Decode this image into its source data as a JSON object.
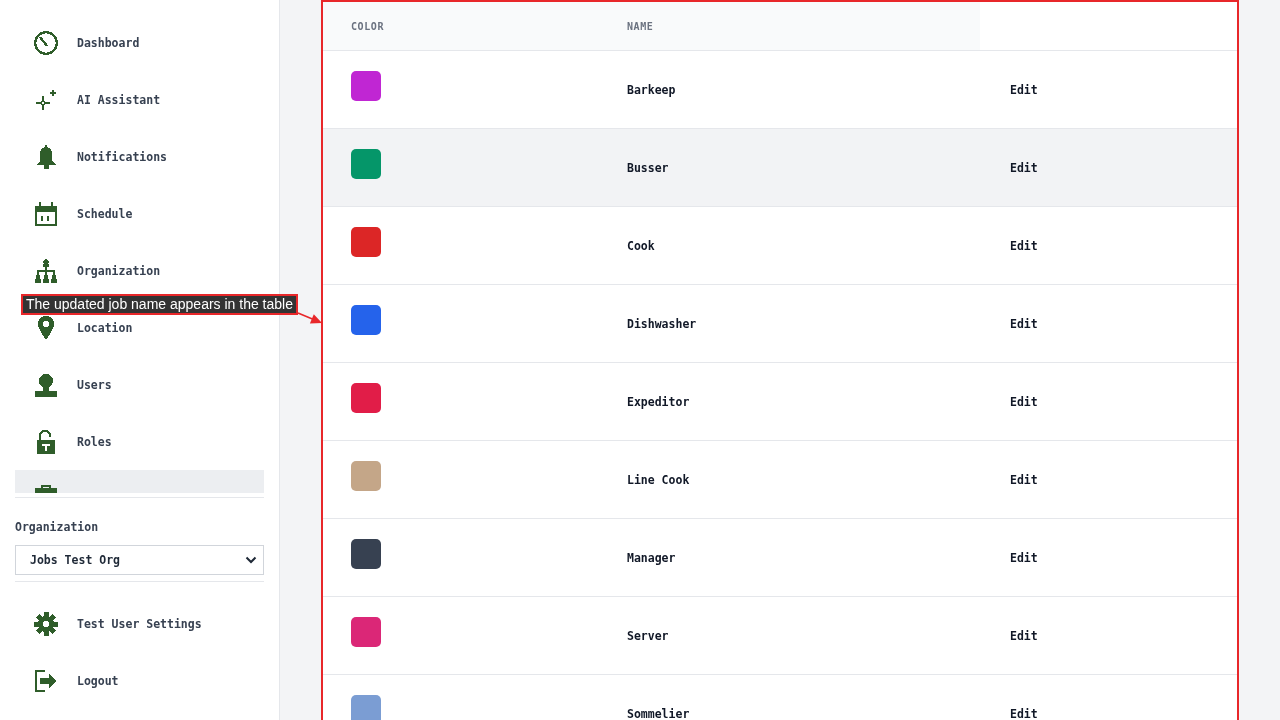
{
  "sidebar": {
    "nav_items": [
      {
        "label": "Dashboard",
        "selected": false
      },
      {
        "label": "AI Assistant",
        "selected": false
      },
      {
        "label": "Notifications",
        "selected": false
      },
      {
        "label": "Schedule",
        "selected": false
      },
      {
        "label": "Organization",
        "selected": false
      },
      {
        "label": "Location",
        "selected": false
      },
      {
        "label": "Users",
        "selected": false
      },
      {
        "label": "Roles",
        "selected": false
      },
      {
        "selected": true
      }
    ],
    "organization_label": "Organization",
    "organization_select": {
      "value": "Jobs Test Org"
    },
    "footer_items": [
      {
        "label": "Test User Settings"
      },
      {
        "label": "Logout"
      }
    ]
  },
  "jobs_table": {
    "columns": [
      "COLOR",
      "NAME"
    ],
    "rows": [
      {
        "color": "#c026d3",
        "name": "Barkeep",
        "action": "Edit",
        "hovered": false
      },
      {
        "color": "#059669",
        "name": "Busser",
        "action": "Edit",
        "hovered": true
      },
      {
        "color": "#dc2626",
        "name": "Cook",
        "action": "Edit",
        "hovered": false
      },
      {
        "color": "#2563eb",
        "name": "Dishwasher",
        "action": "Edit",
        "hovered": false
      },
      {
        "color": "#e11d48",
        "name": "Expeditor",
        "action": "Edit",
        "hovered": false
      },
      {
        "color": "#c4a688",
        "name": "Line Cook",
        "action": "Edit",
        "hovered": false
      },
      {
        "color": "#374151",
        "name": "Manager",
        "action": "Edit",
        "hovered": false
      },
      {
        "color": "#db2777",
        "name": "Server",
        "action": "Edit",
        "hovered": false
      },
      {
        "color": "#7b9dd3",
        "name": "Sommelier",
        "action": "Edit",
        "hovered": false
      }
    ]
  },
  "annotation": {
    "text": "The updated job name appears in the table"
  }
}
